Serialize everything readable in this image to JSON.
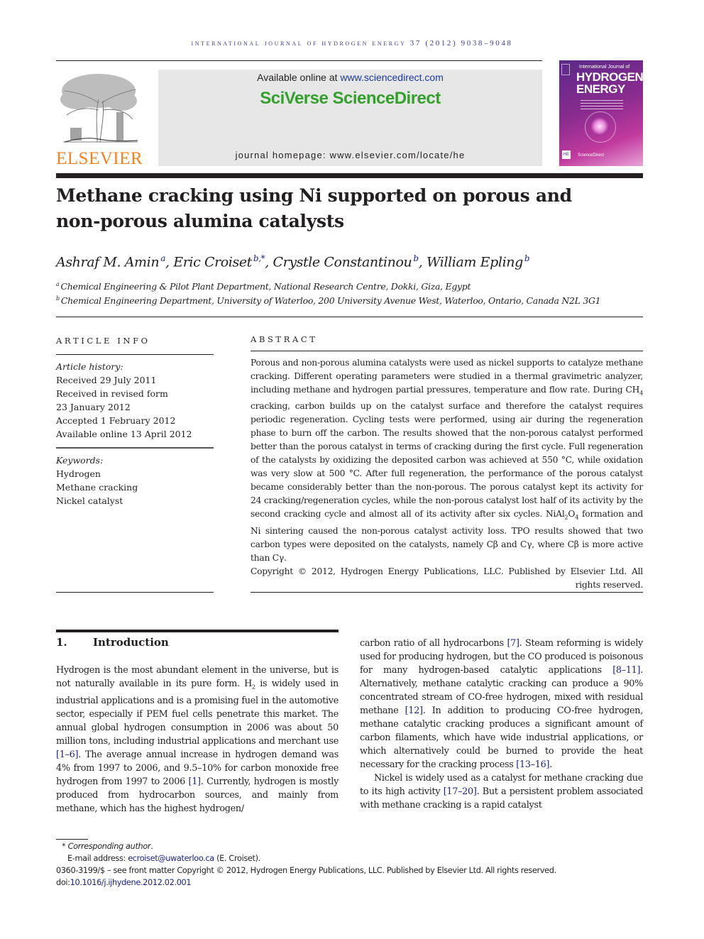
{
  "running_header": "INTERNATIONAL JOURNAL OF HYDROGEN ENERGY 37 (2012) 9038–9048",
  "publisher": {
    "logo_word": "ELSEVIER",
    "logo_color": "#f58220"
  },
  "banner": {
    "available_prefix": "Available online at ",
    "available_link": "www.sciencedirect.com",
    "brand": "SciVerse ScienceDirect",
    "brand_color": "#33a02c",
    "homepage_label": "journal homepage: ",
    "homepage_url": "www.elsevier.com/locate/he"
  },
  "cover": {
    "small": "International Journal of",
    "big_line1": "HYDROGEN",
    "big_line2": "ENERGY",
    "footer": "ScienceDirect",
    "badge": "HE"
  },
  "article": {
    "title_line1": "Methane cracking using Ni supported on porous and",
    "title_line2": "non-porous alumina catalysts",
    "authors": [
      {
        "name": "Ashraf M. Amin",
        "sup": "a"
      },
      {
        "name": "Eric Croiset",
        "sup": "b,*"
      },
      {
        "name": "Crystle Constantinou",
        "sup": "b"
      },
      {
        "name": "William Epling",
        "sup": "b"
      }
    ],
    "affiliations": [
      {
        "sup": "a",
        "text": "Chemical Engineering & Pilot Plant Department, National Research Centre, Dokki, Giza, Egypt"
      },
      {
        "sup": "b",
        "text": "Chemical Engineering Department, University of Waterloo, 200 University Avenue West, Waterloo, Ontario, Canada N2L 3G1"
      }
    ]
  },
  "article_info": {
    "heading": "ARTICLE INFO",
    "history_label": "Article history:",
    "history": [
      "Received 29 July 2011",
      "Received in revised form",
      "23 January 2012",
      "Accepted 1 February 2012",
      "Available online 13 April 2012"
    ],
    "keywords_label": "Keywords:",
    "keywords": [
      "Hydrogen",
      "Methane cracking",
      "Nickel catalyst"
    ]
  },
  "abstract": {
    "heading": "ABSTRACT",
    "p1": "Porous and non-porous alumina catalysts were used as nickel supports to catalyze methane cracking. Different operating parameters were studied in a thermal gravimetric analyzer, including methane and hydrogen partial pressures, temperature and flow rate. During ",
    "ch4": "CH",
    "ch4_sub": "4",
    "p2": " cracking, carbon builds up on the catalyst surface and therefore the catalyst requires periodic regeneration. Cycling tests were performed, using air during the regen­eration phase to burn off the carbon. The results showed that the non-porous catalyst performed better than the porous catalyst in terms of cracking during the first cycle. Full regeneration of the catalysts by oxidizing the deposited carbon was achieved at 550 °C, while oxidation was very slow at 500 °C. After full regeneration, the performance of the porous catalyst became considerably better than the non-porous. The porous catalyst kept its activity for 24 cracking/regeneration cycles, while the non-porous catalyst lost half of its activity by the second cracking cycle and almost all of its activity after six cycles. ",
    "nial": "NiAl",
    "nial_sub1": "2",
    "nial_o": "O",
    "nial_sub2": "4",
    "p3": " formation and Ni sintering caused the non-porous catalyst activity loss. TPO results showed that two carbon types were deposited on the catalysts, namely Cβ and Cγ, where Cβ is more active than Cγ.",
    "copyright": "Copyright © 2012, Hydrogen Energy Publications, LLC. Published by Elsevier Ltd. All rights reserved."
  },
  "introduction": {
    "number": "1.",
    "heading": "Introduction",
    "left": {
      "t1": "Hydrogen is the most abundant element in the universe, but is not naturally available in its pure form. H",
      "h2_sub": "2",
      "t2": " is widely used in industrial applications and is a promising fuel in the auto­motive sector, especially if PEM fuel cells penetrate this market. The annual global hydrogen consumption in 2006 was about 50 million tons, including industrial applications and merchant use ",
      "r1": "[1–6]",
      "t3": ". The average annual increase in hydrogen demand was 4% from 1997 to 2006, and 9.5–10% for carbon monoxide free hydrogen from 1997 to 2006 ",
      "r2": "[1]",
      "t4": ". Currently, hydrogen is mostly produced from hydrocarbon sources, and mainly from methane, which has the highest hydrogen/"
    },
    "right": {
      "t1": "carbon ratio of all hydrocarbons ",
      "r1": "[7]",
      "t2": ". Steam reforming is widely used for producing hydrogen, but the CO produced is poisonous for many hydrogen-based catalytic applications ",
      "r2": "[8–11]",
      "t3": ". Alternatively, methane catalytic cracking can produce a 90% concentrated stream of CO-free hydrogen, mixed with residual methane ",
      "r3": "[12]",
      "t4": ". In addition to producing CO-free hydrogen, methane catalytic cracking produces a significant amount of carbon filaments, which have wide industrial applications, or which alternatively could be burned to provide the heat necessary for the cracking process ",
      "r4": "[13–16]",
      "t5": ".",
      "p2_t1": "Nickel is widely used as a catalyst for methane cracking due to its high activity ",
      "p2_r1": "[17–20]",
      "p2_t2": ". But a persistent problem associated with methane cracking is a rapid catalyst"
    }
  },
  "footnotes": {
    "star": "*",
    "corresponding": "Corresponding author",
    "period": ".",
    "email_label": "E-mail address: ",
    "email": "ecroiset@uwaterloo.ca",
    "email_suffix": " (E. Croiset).",
    "front_matter": "0360-3199/$ – see front matter Copyright © 2012, Hydrogen Energy Publications, LLC. Published by Elsevier Ltd. All rights reserved.",
    "doi_label": "doi:",
    "doi": "10.1016/j.ijhydene.2012.02.001"
  },
  "colors": {
    "link": "#1a237e",
    "header_text": "#3c3c8c",
    "banner_bg": "#e7e7e7"
  }
}
